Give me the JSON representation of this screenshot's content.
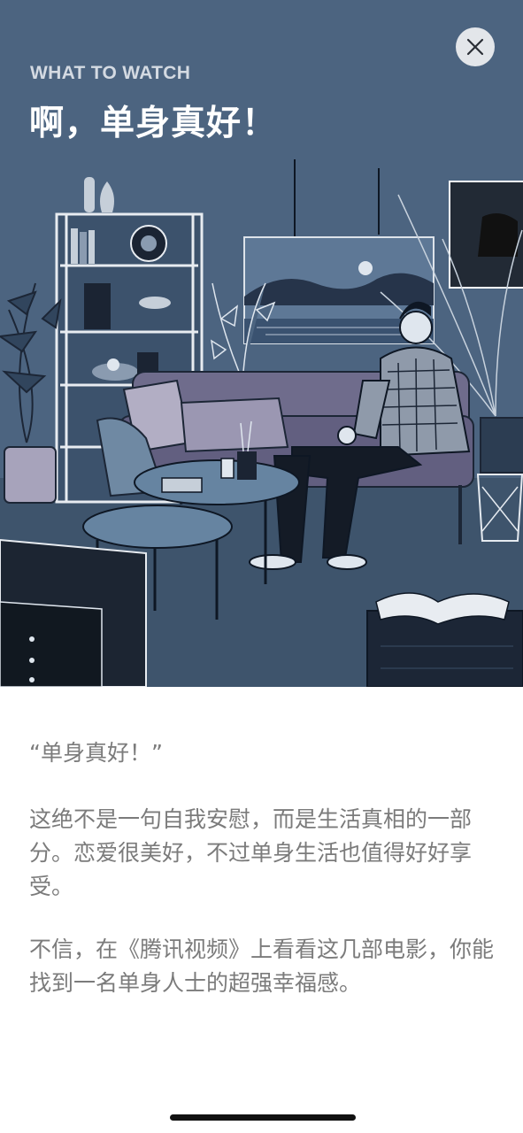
{
  "hero": {
    "kicker": "WHAT TO WATCH",
    "title": "啊，单身真好！",
    "close_icon": "close-icon"
  },
  "article": {
    "quote": "“单身真好！”",
    "paragraphs": [
      "这绝不是一句自我安慰，而是生活真相的一部分。恋爱很美好，不过单身生活也值得好好享受。",
      "不信，在《腾讯视频》上看看这几部电影，你能找到一名单身人士的超强幸福感。"
    ]
  },
  "colors": {
    "hero_background": "#4c6480",
    "body_text": "#7b7b7b",
    "title_text": "#ffffff",
    "kicker_text": "#d4dae2"
  }
}
